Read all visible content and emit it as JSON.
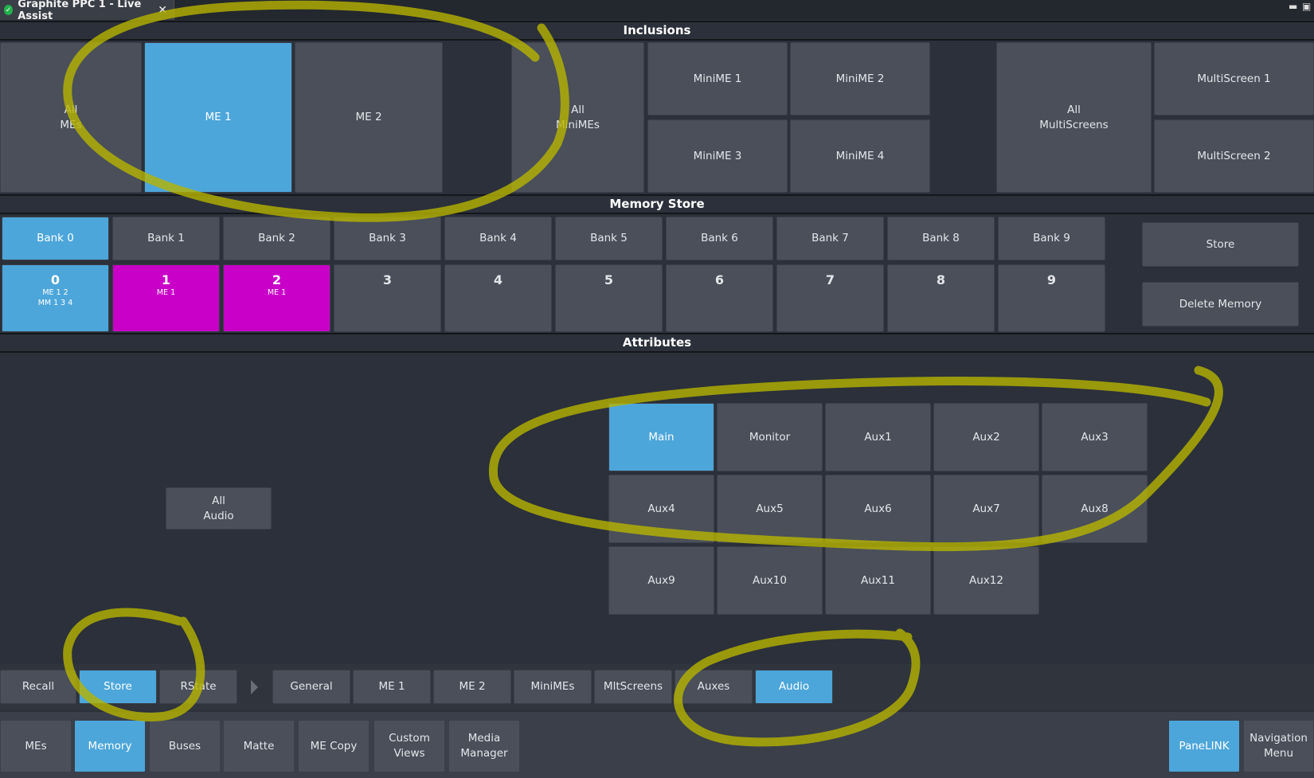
{
  "window": {
    "tab_title": "Graphite PPC 1 - Live Assist",
    "close": "✕",
    "min": "▬",
    "restore": "▣"
  },
  "sections": {
    "inclusions": "Inclusions",
    "memory_store": "Memory Store",
    "attributes": "Attributes"
  },
  "inclusions": {
    "all_mes": "All\nMEs",
    "me1": "ME 1",
    "me2": "ME 2",
    "all_minimes": "All\nMiniMEs",
    "minime1": "MiniME 1",
    "minime2": "MiniME 2",
    "minime3": "MiniME 3",
    "minime4": "MiniME 4",
    "all_multiscreens": "All\nMultiScreens",
    "multiscreen1": "MultiScreen 1",
    "multiscreen2": "MultiScreen 2"
  },
  "banks": [
    "Bank 0",
    "Bank 1",
    "Bank 2",
    "Bank 3",
    "Bank 4",
    "Bank 5",
    "Bank 6",
    "Bank 7",
    "Bank 8",
    "Bank 9"
  ],
  "memories": [
    {
      "num": "0",
      "sub": "ME 1 2\nMM 1 3 4"
    },
    {
      "num": "1",
      "sub": "ME 1"
    },
    {
      "num": "2",
      "sub": "ME 1"
    },
    {
      "num": "3",
      "sub": ""
    },
    {
      "num": "4",
      "sub": ""
    },
    {
      "num": "5",
      "sub": ""
    },
    {
      "num": "6",
      "sub": ""
    },
    {
      "num": "7",
      "sub": ""
    },
    {
      "num": "8",
      "sub": ""
    },
    {
      "num": "9",
      "sub": ""
    }
  ],
  "memory_actions": {
    "store": "Store",
    "delete": "Delete Memory"
  },
  "attributes": {
    "all_audio": "All\nAudio",
    "outputs": [
      "Main",
      "Monitor",
      "Aux1",
      "Aux2",
      "Aux3",
      "Aux4",
      "Aux5",
      "Aux6",
      "Aux7",
      "Aux8",
      "Aux9",
      "Aux10",
      "Aux11",
      "Aux12"
    ]
  },
  "mode_bar": {
    "recall": "Recall",
    "store": "Store",
    "rstate": "RState",
    "tabs": [
      "General",
      "ME 1",
      "ME 2",
      "MiniMEs",
      "MltScreens",
      "Auxes",
      "Audio"
    ]
  },
  "nav_bar": {
    "items": [
      "MEs",
      "Memory",
      "Buses",
      "Matte",
      "ME Copy",
      "Custom\nViews",
      "Media\nManager"
    ],
    "panelink": "PaneLINK",
    "navigation": "Navigation\nMenu"
  },
  "colors": {
    "active": "#4ca6da",
    "magenta": "#c800c8",
    "annotation": "#b7b400"
  }
}
